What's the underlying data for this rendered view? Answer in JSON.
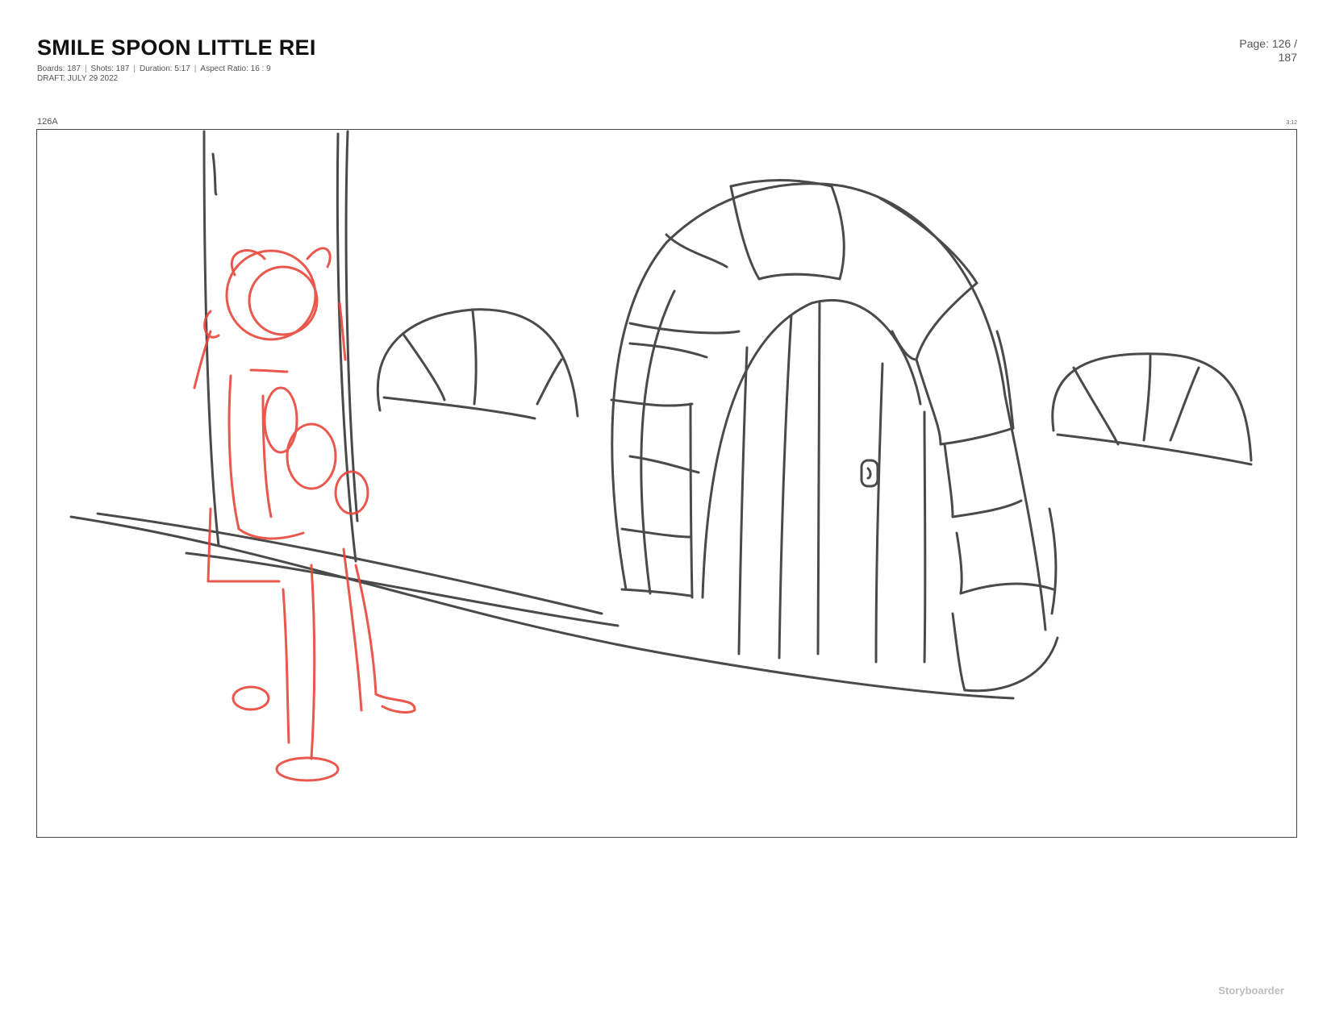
{
  "header": {
    "title": "SMILE SPOON LITTLE REI",
    "stats": {
      "boards": "Boards: 187",
      "shots": "Shots: 187",
      "duration": "Duration: 5:17",
      "aspect": "Aspect Ratio: 16 : 9"
    },
    "draft": "DRAFT: JULY 29 2022",
    "page_label": "Page: 126 /",
    "page_total": "187"
  },
  "board": {
    "id": "126A",
    "duration": "3:12",
    "sketch_colors": {
      "background_lines": "#2b2b2b",
      "character_lines": "#e8463a"
    }
  },
  "footer": {
    "brand": "Storyboarder"
  }
}
